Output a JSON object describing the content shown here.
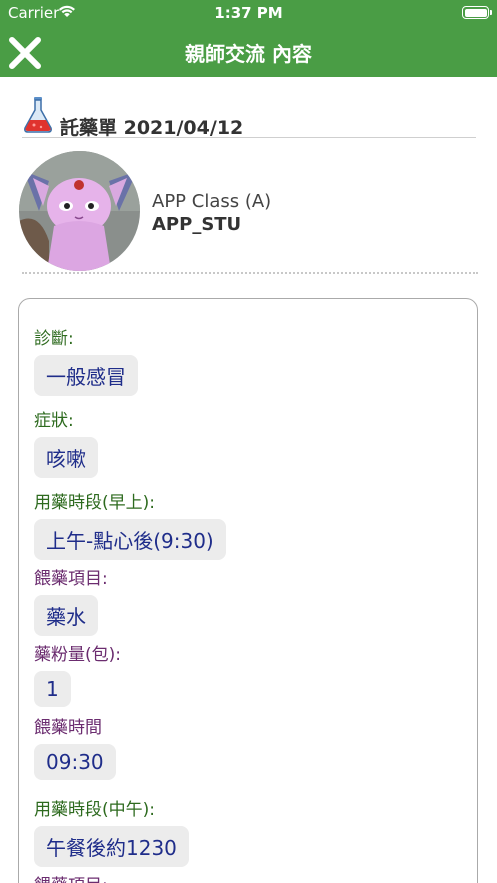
{
  "status_bar": {
    "carrier": "Carrier",
    "time": "1:37 PM",
    "battery_level": 1.0
  },
  "nav": {
    "title": "親師交流 內容",
    "close_icon": "close-icon"
  },
  "header": {
    "icon": "flask-icon",
    "title": "託藥單 2021/04/12"
  },
  "profile": {
    "class_name": "APP Class (A)",
    "student_id": "APP_STU"
  },
  "colors": {
    "primary_green": "#4a9d45",
    "label_green": "#2d6a1e",
    "label_purple": "#6b2c6f",
    "value_blue": "#1f2d8a",
    "pill_bg": "#ececec"
  },
  "fields": [
    {
      "label": "診斷:",
      "value": "一般感冒"
    },
    {
      "label": "症狀:",
      "value": "咳嗽"
    },
    {
      "label": "用藥時段(早上):",
      "value": "上午-點心後(9:30)"
    },
    {
      "label": "餵藥項目:",
      "value": "藥水"
    },
    {
      "label": "藥粉量(包):",
      "value": "1"
    },
    {
      "label": "餵藥時間",
      "value": "09:30"
    },
    {
      "label": "用藥時段(中午):",
      "value": "午餐後約1230"
    },
    {
      "label": "餵藥項目:",
      "value": ""
    }
  ]
}
